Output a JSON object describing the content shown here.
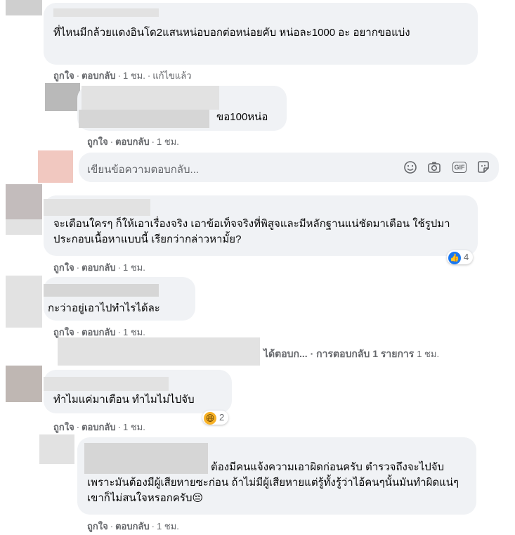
{
  "actions": {
    "like": "ถูกใจ",
    "reply": "ตอบกลับ",
    "separator": "·"
  },
  "comments": [
    {
      "text": "ที่ไหนมีกล้วยแดงอินโด2แสนหน่อบอกต่อหน่อยคับ หน่อละ1000 อะ อยากขอแบ่ง",
      "time": "1 ชม.",
      "edited": "แก้ไขแล้ว"
    },
    {
      "text": "ขอ100หน่อ",
      "time": "1 ชม."
    },
    {
      "text": "จะเตือนใครๆ ก็ให้เอาเรื่องจริง เอาข้อเท็จจริงที่พิสูจและมีหลักฐานแน่ชัดมาเตือน ใช้รูปมาประกอบเนื้อหาแบบนี้ เรียกว่ากล่าวหามั้ย?",
      "time": "1 ชม.",
      "reaction_count": "4"
    },
    {
      "text": "กะว่าอยู่เอาไปทำไรได้ละ",
      "time": "1 ชม."
    },
    {
      "text": "ทำไมแค่มาเตือน ทำไมไม่ไปจับ",
      "time": "1 ชม.",
      "reaction_count": "2"
    },
    {
      "text": "ต้องมีคนแจ้งความเอาผิดก่อนครับ ตำรวจถึงจะไปจับ เพราะมันต้องมีผู้เสียหายซะก่อน ถ้าไม่มีผู้เสียหายแต่รู้ทั้งรู้ว่าไอ้คนๆนั้นมันทำผิดแน่ๆ เขาก็ไม่สนใจหรอกครับ😔",
      "time": "1 ชม."
    }
  ],
  "reply_box": {
    "placeholder": "เขียนข้อความตอบกลับ..."
  },
  "view_replies": {
    "prefix": "ได้ตอบก...",
    "label": "· การตอบกลับ 1 รายการ",
    "time": "1 ชม."
  }
}
